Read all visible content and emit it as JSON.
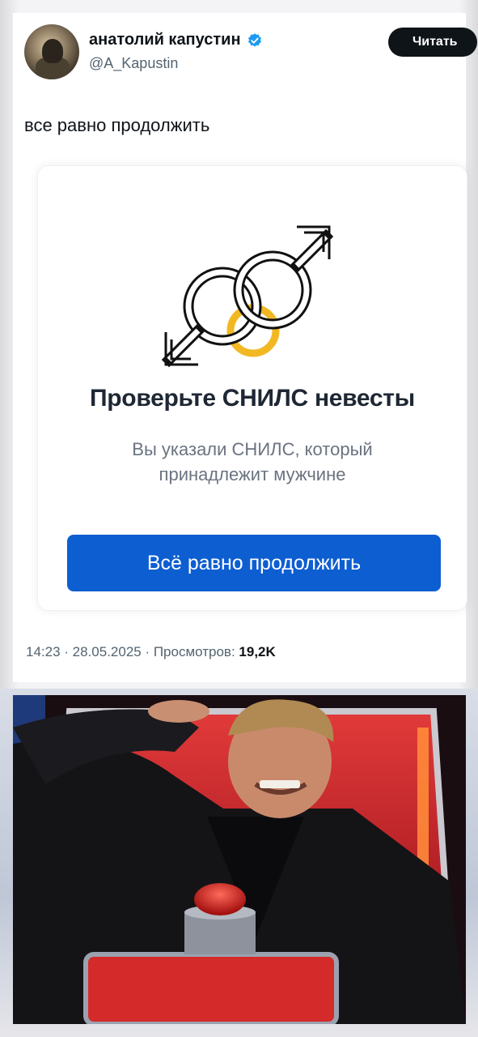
{
  "tweet": {
    "display_name": "анатолий капустин",
    "handle": "@A_Kapustin",
    "follow_label": "Читать",
    "text": "все равно продолжить",
    "timestamp": "14:23 · 28.05.2025 · Просмотров:",
    "views": "19,2K"
  },
  "embed": {
    "title": "Проверьте СНИЛС невесты",
    "subtitle_line1": "Вы указали СНИЛС, который",
    "subtitle_line2": "принадлежит мужчине",
    "button_label": "Всё равно продолжить"
  },
  "colors": {
    "button_blue": "#0d5ed1",
    "verified_blue": "#1d9bf0",
    "ring_gold": "#f2b824",
    "chair_red": "#c8202a"
  },
  "icons": {
    "rings": "male-symbols-wedding-rings-icon",
    "verified": "verified-badge-icon"
  }
}
